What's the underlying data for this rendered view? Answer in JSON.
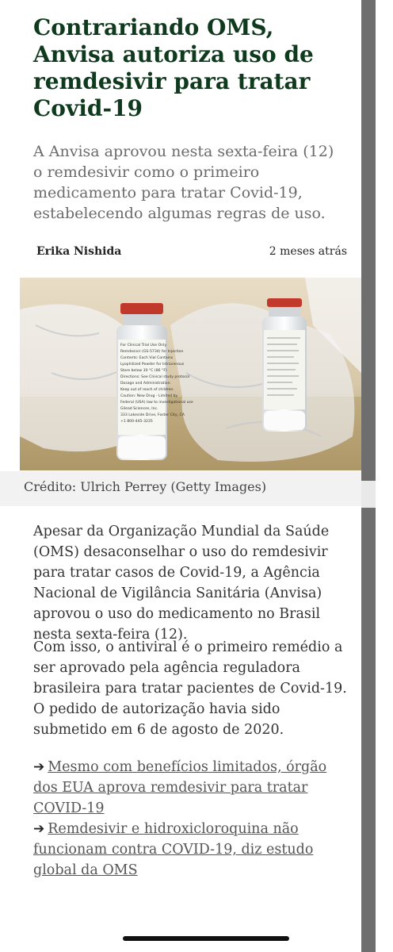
{
  "article": {
    "headline": "Contrariando OMS, Anvisa autoriza uso de remdesivir para tratar Covid-19",
    "lead": "A Anvisa aprovou nesta sexta-feira (12) o remdesivir como o primeiro medicamento para tratar Covid-19, estabelecendo algumas regras de uso.",
    "author": "Erika Nishida",
    "time": "2 meses atrás",
    "caption": "Crédito: Ulrich Perrey (Getty Images)",
    "paragraphs": [
      "Apesar da Organização Mundial da Saúde (OMS) desaconselhar o uso do remdesivir para tratar casos de Covid-19, a Agência Nacional de Vigilância Sanitária (Anvisa) aprovou o uso do medicamento no Brasil nesta sexta-feira (12).",
      "Com isso, o antiviral é o primeiro remédio a ser aprovado pela agência reguladora brasileira para tratar pacientes de Covid-19. O pedido de autorização havia sido submetido em 6 de agosto de 2020."
    ],
    "related_links": [
      {
        "text": "Mesmo com benefícios limitados, órgão dos EUA aprova remdesivir para tratar COVID-19",
        "icon": "arrow-right-icon"
      },
      {
        "text": "Remdesivir e hidroxicloroquina não funcionam contra COVID-19, diz estudo global da OMS",
        "icon": "arrow-right-icon"
      }
    ]
  },
  "photo": {
    "description_icon": "medicine-vials-photo",
    "vial_label_lines": [
      "For Clinical Trial Use Only",
      "Remdesivir (GS-5734) for Injection",
      "Contents: Each Vial Contains",
      "Lyophilized Powder for Intravenous",
      "Store below 30 °C (86 °F)",
      "Directions: See Clinical study protocol",
      "Dosage and Administration.",
      "Keep out of reach of children.",
      "Caution: New Drug - Limited by",
      "Federal (USA) law to investigational use",
      "Gilead Sciences, Inc.",
      "333 Lakeside Drive, Foster City, CA",
      "+1 800-445-3235"
    ]
  },
  "colors": {
    "headline": "#0f3a1e",
    "lead": "#6b6b6b",
    "scrollbar": "#6e6e6e",
    "cap_red": "#c0392b"
  }
}
